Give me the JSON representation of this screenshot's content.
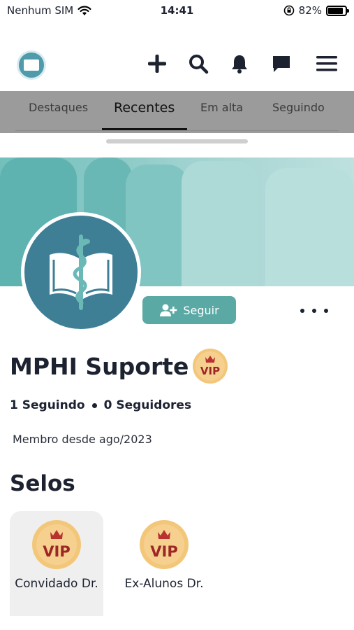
{
  "status_bar": {
    "carrier": "Nenhum SIM",
    "time": "14:41",
    "battery_percent": "82%",
    "battery_level": 0.82
  },
  "header": {
    "logo": "mphi-logo",
    "actions": [
      "add-icon",
      "search-icon",
      "bell-icon",
      "chat-icon",
      "menu-icon"
    ]
  },
  "tabs": [
    {
      "label": "Destaques",
      "active": false
    },
    {
      "label": "Recentes",
      "active": true
    },
    {
      "label": "Em alta",
      "active": false
    },
    {
      "label": "Seguindo",
      "active": false
    }
  ],
  "profile": {
    "name": "MPHI Suporte",
    "name_badge": "VIP",
    "follow_label": "Seguir",
    "following": "1 Seguindo",
    "followers": "0 Seguidores",
    "member_since": "Membro desde ago/2023"
  },
  "badges": {
    "title": "Selos",
    "items": [
      {
        "badge": "VIP",
        "label": "Convidado Dr.",
        "selected": true
      },
      {
        "badge": "VIP",
        "label": "Ex-Alunos Dr.",
        "selected": false
      }
    ]
  },
  "colors": {
    "accent": "#5aa9a4",
    "avatar_bg": "#3e7f96",
    "vip_gold": "#f3c77a",
    "vip_red": "#b8322f",
    "tabs_overlay": "#9b9b9b"
  }
}
